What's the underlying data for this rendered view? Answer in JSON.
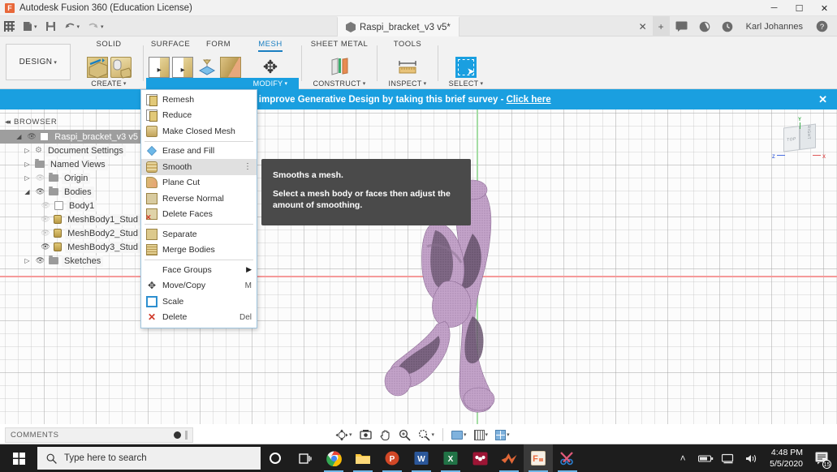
{
  "window": {
    "title": "Autodesk Fusion 360 (Education License)",
    "app_icon": "fusion-logo-icon",
    "minimize": "─",
    "maximize": "☐",
    "close": "✕"
  },
  "quickbar": {
    "grid_icon": "app-grid-icon",
    "new_icon": "new-document-icon",
    "save_icon": "save-icon",
    "undo_icon": "undo-icon",
    "redo_icon": "redo-icon",
    "caret": "▾",
    "document_tab": "Raspi_bracket_v3 v5*",
    "tab_close": "✕",
    "new_tab": "+",
    "comments_icon": "comment-icon",
    "notifications_icon": "activity-icon",
    "jobstatus_icon": "job-status-icon",
    "user": "Karl Johannes",
    "help_icon": "help-icon"
  },
  "ribbon": {
    "workspace": "DESIGN",
    "workspace_caret": "▾",
    "tabs": [
      {
        "label": "SOLID",
        "active": false,
        "foot": "CREATE",
        "foot_caret": "▾",
        "foot_active": false
      },
      {
        "label": "SURFACE",
        "active": false,
        "foot": "",
        "foot_caret": "",
        "foot_active": false
      },
      {
        "label": "FORM",
        "active": false,
        "foot": "",
        "foot_caret": "",
        "foot_active": false
      },
      {
        "label": "MESH",
        "active": true,
        "foot": "MODIFY",
        "foot_caret": "▾",
        "foot_active": true
      },
      {
        "label": "SHEET METAL",
        "active": false,
        "foot": "CONSTRUCT",
        "foot_caret": "▾",
        "foot_active": false
      },
      {
        "label": "TOOLS",
        "active": false,
        "foot": "INSPECT",
        "foot_caret": "▾",
        "foot_active": false
      },
      {
        "label": "",
        "active": false,
        "foot": "SELECT",
        "foot_caret": "▾",
        "foot_active": false
      }
    ]
  },
  "banner": {
    "text": "Help us to improve Generative Design by taking this brief survey - ",
    "link": "Click here",
    "close": "✕",
    "color": "#1a9fe0"
  },
  "browser": {
    "header": "BROWSER",
    "collapse_icon": "◂◂",
    "items": [
      {
        "label": "Raspi_bracket_v3 v5",
        "twisty": "◢",
        "eye": "visible",
        "icon": "component-icon",
        "indent": 0,
        "selected": true
      },
      {
        "label": "Document Settings",
        "twisty": "▷",
        "eye": "none",
        "icon": "gear-icon",
        "indent": 1,
        "selected": false
      },
      {
        "label": "Named Views",
        "twisty": "▷",
        "eye": "none",
        "icon": "folder-icon",
        "indent": 1,
        "selected": false
      },
      {
        "label": "Origin",
        "twisty": "▷",
        "eye": "hidden",
        "icon": "folder-icon",
        "indent": 1,
        "selected": false
      },
      {
        "label": "Bodies",
        "twisty": "◢",
        "eye": "visible",
        "icon": "folder-icon",
        "indent": 1,
        "selected": false
      },
      {
        "label": "Body1",
        "twisty": "",
        "eye": "hidden",
        "icon": "component-icon",
        "indent": 2,
        "selected": false
      },
      {
        "label": "MeshBody1_Stud",
        "twisty": "",
        "eye": "hidden",
        "icon": "mesh-icon",
        "indent": 2,
        "selected": false
      },
      {
        "label": "MeshBody2_Stud",
        "twisty": "",
        "eye": "hidden",
        "icon": "mesh-icon",
        "indent": 2,
        "selected": false
      },
      {
        "label": "MeshBody3_Stud",
        "twisty": "",
        "eye": "visible",
        "icon": "mesh-icon",
        "indent": 2,
        "selected": false
      },
      {
        "label": "Sketches",
        "twisty": "▷",
        "eye": "visible",
        "icon": "folder-icon",
        "indent": 1,
        "selected": false
      }
    ]
  },
  "modify_menu": {
    "items": [
      {
        "label": "Remesh",
        "icon": "remesh-icon",
        "shortcut": "",
        "kind": "item",
        "highlight": false
      },
      {
        "label": "Reduce",
        "icon": "reduce-icon",
        "shortcut": "",
        "kind": "item",
        "highlight": false
      },
      {
        "label": "Make Closed Mesh",
        "icon": "make-closed-mesh-icon",
        "shortcut": "",
        "kind": "item",
        "highlight": false
      },
      {
        "label": "",
        "icon": "",
        "shortcut": "",
        "kind": "divider",
        "highlight": false
      },
      {
        "label": "Erase and Fill",
        "icon": "erase-and-fill-icon",
        "shortcut": "",
        "kind": "item",
        "highlight": false
      },
      {
        "label": "Smooth",
        "icon": "smooth-icon",
        "shortcut": "",
        "kind": "item",
        "highlight": true,
        "overflow": "⋮"
      },
      {
        "label": "Plane Cut",
        "icon": "plane-cut-icon",
        "shortcut": "",
        "kind": "item",
        "highlight": false
      },
      {
        "label": "Reverse Normal",
        "icon": "reverse-normal-icon",
        "shortcut": "",
        "kind": "item",
        "highlight": false
      },
      {
        "label": "Delete Faces",
        "icon": "delete-faces-icon",
        "shortcut": "",
        "kind": "item",
        "highlight": false
      },
      {
        "label": "",
        "icon": "",
        "shortcut": "",
        "kind": "divider",
        "highlight": false
      },
      {
        "label": "Separate",
        "icon": "separate-icon",
        "shortcut": "",
        "kind": "item",
        "highlight": false
      },
      {
        "label": "Merge Bodies",
        "icon": "merge-bodies-icon",
        "shortcut": "",
        "kind": "item",
        "highlight": false
      },
      {
        "label": "",
        "icon": "",
        "shortcut": "",
        "kind": "divider",
        "highlight": false
      },
      {
        "label": "Face Groups",
        "icon": "",
        "shortcut": "",
        "kind": "submenu",
        "highlight": false,
        "arrow": "▶"
      },
      {
        "label": "Move/Copy",
        "icon": "move-copy-icon",
        "shortcut": "M",
        "kind": "item",
        "highlight": false
      },
      {
        "label": "Scale",
        "icon": "scale-icon",
        "shortcut": "",
        "kind": "item",
        "highlight": false
      },
      {
        "label": "Delete",
        "icon": "delete-icon",
        "shortcut": "Del",
        "kind": "item",
        "highlight": false
      }
    ]
  },
  "tooltip": {
    "title": "Smooths a mesh.",
    "body": "Select a mesh body or faces then adjust the amount of smoothing.",
    "background": "#4a4a4a"
  },
  "canvas": {
    "grid_visible": true,
    "x_axis_color": "#f59a9a",
    "z_axis_color": "#a4dda4",
    "model_color": "#bd9dc4",
    "viewcube": {
      "face_top": "TOP",
      "face_right": "RIGHT",
      "axis_x": "X",
      "axis_y": "Y",
      "axis_z": "Z"
    }
  },
  "comments_bar": {
    "label": "COMMENTS",
    "collapse_icon": "comments-toggle-icon"
  },
  "navbar": {
    "items": [
      {
        "name": "orbit-icon",
        "glyph": "✤",
        "caret": "▾"
      },
      {
        "name": "look-at-icon",
        "glyph": "▣",
        "caret": ""
      },
      {
        "name": "pan-icon",
        "glyph": "✋",
        "caret": ""
      },
      {
        "name": "zoom-icon",
        "glyph": "⌕",
        "caret": ""
      },
      {
        "name": "zoom-window-icon",
        "glyph": "⌕",
        "caret": "▾"
      },
      {
        "name": "display-settings-icon",
        "glyph": "",
        "caret": "▾"
      },
      {
        "name": "grid-snaps-icon",
        "glyph": "",
        "caret": "▾"
      },
      {
        "name": "viewports-icon",
        "glyph": "",
        "caret": "▾"
      }
    ]
  },
  "taskbar": {
    "start_icon": "windows-start-icon",
    "search_placeholder": "Type here to search",
    "search_icon": "search-icon",
    "cortana_icon": "cortana-icon",
    "taskview_icon": "task-view-icon",
    "apps": [
      {
        "name": "chrome-icon",
        "color": "#4285f4",
        "running": true,
        "active": false
      },
      {
        "name": "file-explorer-icon",
        "color": "#ffc83d",
        "running": true,
        "active": false
      },
      {
        "name": "powerpoint-icon",
        "color": "#d24726",
        "running": true,
        "active": false
      },
      {
        "name": "word-icon",
        "color": "#2b579a",
        "running": true,
        "active": false
      },
      {
        "name": "excel-icon",
        "color": "#217346",
        "running": true,
        "active": false
      },
      {
        "name": "mendeley-icon",
        "color": "#9d1535",
        "running": false,
        "active": false
      },
      {
        "name": "matlab-icon",
        "color": "#e16737",
        "running": true,
        "active": false
      },
      {
        "name": "fusion360-icon",
        "color": "#f5a623",
        "running": true,
        "active": true
      },
      {
        "name": "snipping-tool-icon",
        "color": "#e05a7a",
        "running": true,
        "active": false
      }
    ],
    "tray": {
      "expand_icon": "˄",
      "battery_icon": "battery-icon",
      "network_icon": "network-icon",
      "volume_icon": "🔊",
      "time": "4:48 PM",
      "date": "5/5/2020",
      "notification_count": "15"
    }
  }
}
